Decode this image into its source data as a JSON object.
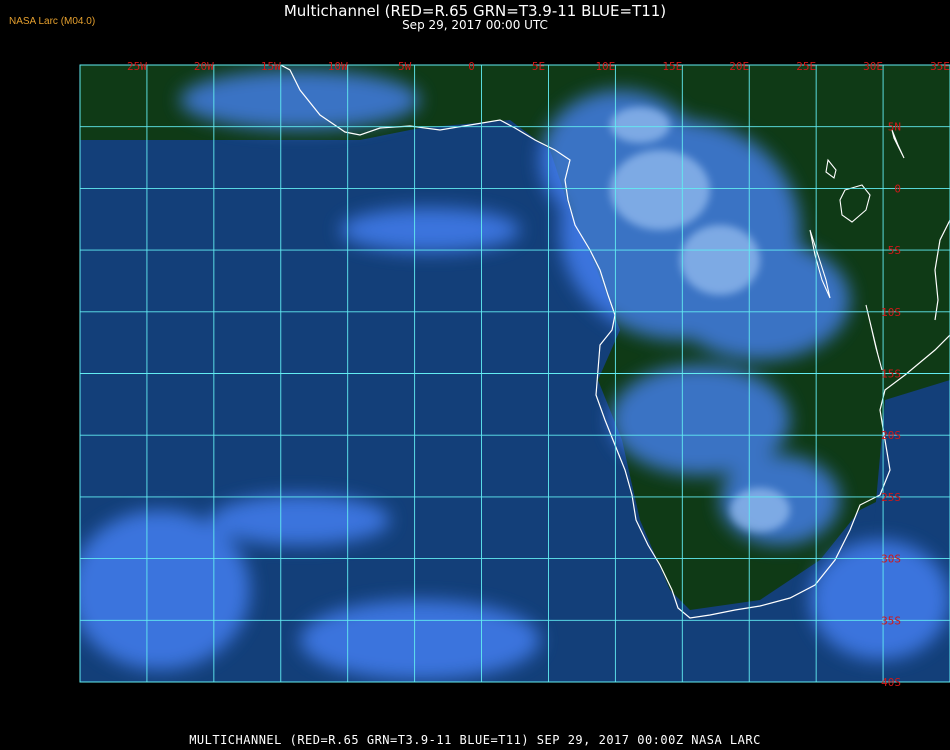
{
  "title": "Multichannel (RED=R.65 GRN=T3.9-11 BLUE=T11)",
  "subtitle": "Sep 29, 2017 00:00 UTC",
  "badge": "NASA Larc (M04.0)",
  "footer": "MULTICHANNEL (RED=R.65 GRN=T3.9-11 BLUE=T11) SEP 29, 2017 00:00Z  NASA LARC",
  "map": {
    "lon_labels": [
      "25W",
      "20W",
      "15W",
      "10W",
      "5W",
      "0",
      "5E",
      "10E",
      "15E",
      "20E",
      "25E",
      "30E",
      "35E"
    ],
    "lat_labels": [
      "5N",
      "0",
      "5S",
      "10S",
      "15S",
      "20S",
      "25S",
      "30S",
      "35S",
      "40S"
    ],
    "lon_range": [
      -30,
      35
    ],
    "lat_range": [
      -40,
      10
    ],
    "grid": true,
    "colors": {
      "background": "#000000",
      "land": "#0f3a16",
      "ocean": "#133f79",
      "cloud": "#4a86ff",
      "cloud_bright": "#b5d7ff",
      "grid_lines": "#62ecf2",
      "coastline": "#ffffff",
      "labels": "#d01818",
      "badge": "#e6a02e"
    }
  }
}
